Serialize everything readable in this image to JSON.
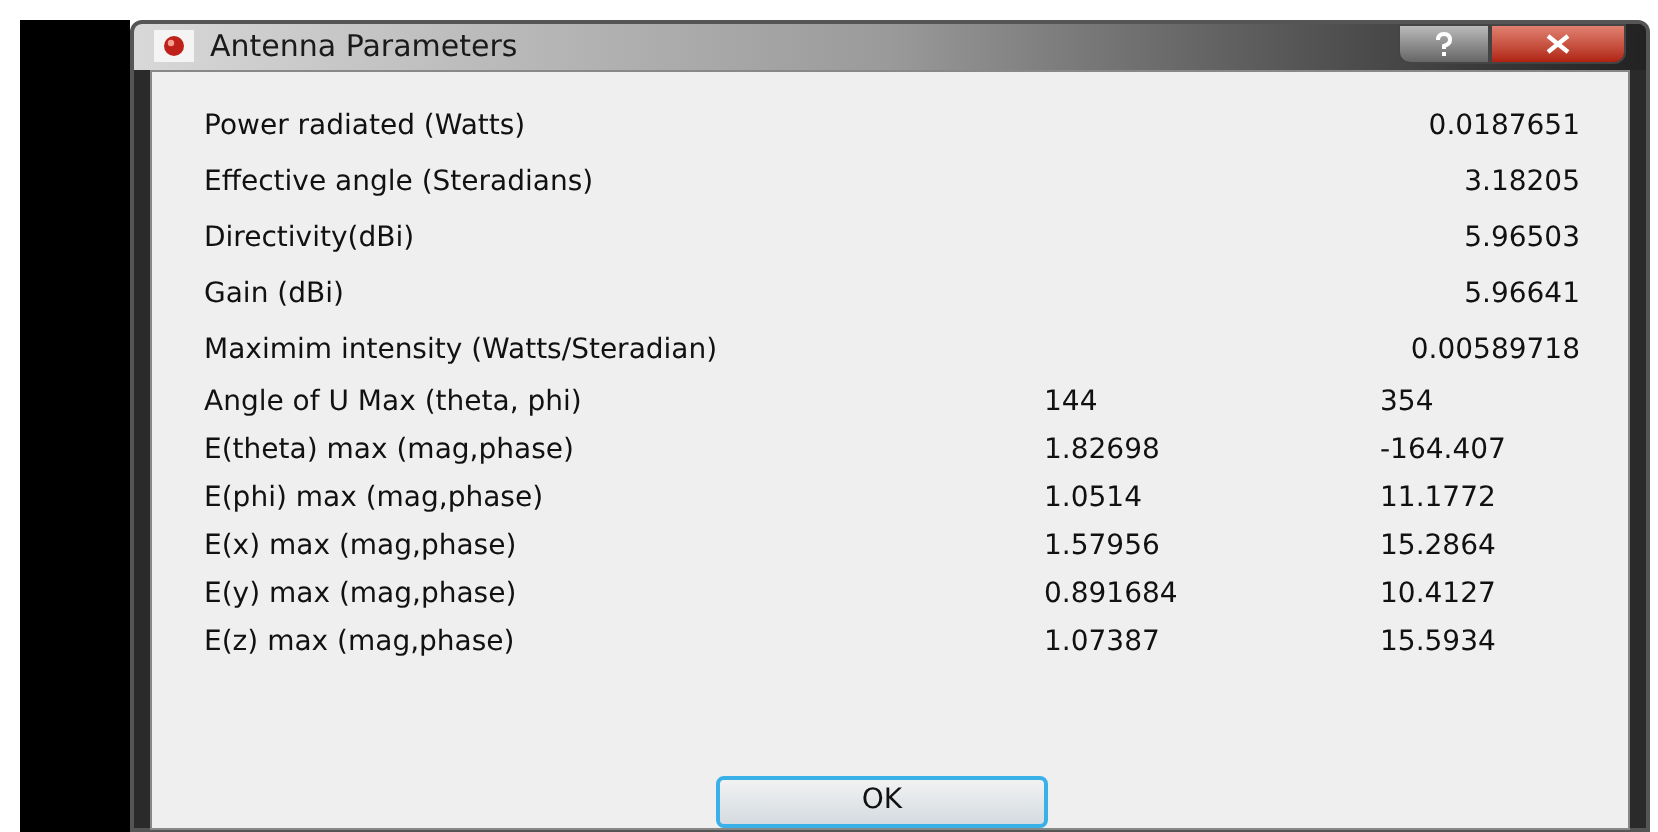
{
  "window": {
    "title": "Antenna Parameters"
  },
  "rows": [
    {
      "kind": "single",
      "label": "Power radiated (Watts)",
      "value": "0.0187651"
    },
    {
      "kind": "single",
      "label": "Effective angle (Steradians)",
      "value": "3.18205"
    },
    {
      "kind": "single",
      "label": "Directivity(dBi)",
      "value": "5.96503"
    },
    {
      "kind": "single",
      "label": "Gain (dBi)",
      "value": "5.96641"
    },
    {
      "kind": "single",
      "label": "Maximim intensity (Watts/Steradian)",
      "value": "0.00589718"
    },
    {
      "kind": "pair",
      "label": "Angle of U Max (theta, phi)",
      "value_1": "144",
      "value_2": "354"
    },
    {
      "kind": "pair",
      "label": "E(theta) max (mag,phase)",
      "value_1": "1.82698",
      "value_2": "-164.407"
    },
    {
      "kind": "pair",
      "label": "E(phi) max (mag,phase)",
      "value_1": "1.0514",
      "value_2": "11.1772"
    },
    {
      "kind": "pair",
      "label": "E(x) max (mag,phase)",
      "value_1": "1.57956",
      "value_2": "15.2864"
    },
    {
      "kind": "pair",
      "label": "E(y) max (mag,phase)",
      "value_1": "0.891684",
      "value_2": "10.4127"
    },
    {
      "kind": "pair",
      "label": "E(z) max (mag,phase)",
      "value_1": "1.07387",
      "value_2": "15.5934"
    }
  ],
  "buttons": [
    "OK"
  ]
}
